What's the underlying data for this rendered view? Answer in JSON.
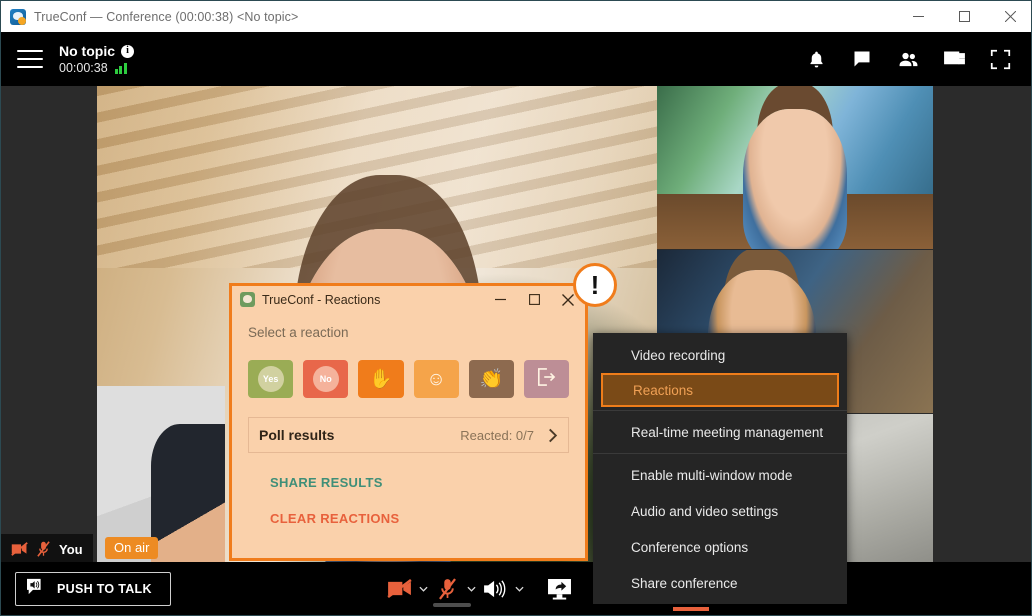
{
  "window": {
    "title": "TrueConf — Conference (00:00:38) <No topic>",
    "app_icon": "trueconf-icon",
    "controls": [
      {
        "name": "minimize-button",
        "glyph": "minimize-icon"
      },
      {
        "name": "maximize-button",
        "glyph": "maximize-icon"
      },
      {
        "name": "close-button",
        "glyph": "close-icon"
      }
    ]
  },
  "header": {
    "menu_icon": "hamburger-icon",
    "topic": "No topic",
    "info_glyph": "i",
    "elapsed": "00:00:38",
    "signal_icon": "signal-bars-icon",
    "actions": [
      {
        "name": "notifications-button",
        "icon": "bell-icon"
      },
      {
        "name": "chat-button",
        "icon": "chat-bubble-icon"
      },
      {
        "name": "participants-button",
        "icon": "people-icon"
      },
      {
        "name": "layout-button",
        "icon": "video-layout-icon"
      },
      {
        "name": "fullscreen-button",
        "icon": "fullscreen-icon"
      }
    ]
  },
  "stage": {
    "self_tile": {
      "name_label": "You",
      "status_badge": "On air",
      "camera_icon": "camera-off-icon",
      "mic_icon": "mic-off-icon"
    },
    "tiles": [
      {
        "name": "video-tile-speaker"
      },
      {
        "name": "video-tile-participant-1"
      },
      {
        "name": "video-tile-participant-2"
      },
      {
        "name": "video-tile-participant-3"
      }
    ]
  },
  "bottombar": {
    "push_to_talk": {
      "label": "PUSH TO TALK",
      "icon": "speaker-bubble-icon"
    },
    "controls": [
      {
        "name": "camera-toggle",
        "icon": "camera-off-icon",
        "state": "off",
        "has_caret": true
      },
      {
        "name": "microphone-toggle",
        "icon": "mic-off-icon",
        "state": "off",
        "has_caret": true
      },
      {
        "name": "speaker-volume",
        "icon": "speaker-icon",
        "state": "on",
        "has_caret": true
      },
      {
        "name": "share-screen-button",
        "icon": "screen-share-icon",
        "state": "on",
        "has_caret": false
      }
    ],
    "more_icon": "more-dots-icon"
  },
  "context_menu": {
    "items": [
      {
        "label": "Video recording",
        "highlighted": false,
        "separator_after": false
      },
      {
        "label": "Reactions",
        "highlighted": true,
        "separator_after": true
      },
      {
        "label": "Real-time meeting management",
        "highlighted": false,
        "separator_after": true
      },
      {
        "label": "Enable multi-window mode",
        "highlighted": false,
        "separator_after": false
      },
      {
        "label": "Audio and video settings",
        "highlighted": false,
        "separator_after": false
      },
      {
        "label": "Conference options",
        "highlighted": false,
        "separator_after": false
      },
      {
        "label": "Share conference",
        "highlighted": false,
        "separator_after": false
      }
    ],
    "highlight_border_color": "#ef7d1a",
    "highlight_fill_color": "#7a4a17"
  },
  "dialog": {
    "icon": "trueconf-icon",
    "title": "TrueConf - Reactions",
    "controls": [
      {
        "name": "dialog-minimize-button",
        "glyph": "minimize-icon"
      },
      {
        "name": "dialog-maximize-button",
        "glyph": "maximize-icon"
      },
      {
        "name": "dialog-close-button",
        "glyph": "close-icon"
      }
    ],
    "prompt": "Select a reaction",
    "reactions": [
      {
        "name": "reaction-yes",
        "label": "Yes",
        "kind": "pill",
        "color": "#9aac55"
      },
      {
        "name": "reaction-no",
        "label": "No",
        "kind": "pill",
        "color": "#e8674a"
      },
      {
        "name": "reaction-raise-hand",
        "label": "✋",
        "kind": "glyph",
        "color": "#f07c1b"
      },
      {
        "name": "reaction-smile",
        "label": "☺",
        "kind": "glyph",
        "color": "#f5a44a"
      },
      {
        "name": "reaction-applause",
        "label": "👏",
        "kind": "glyph",
        "color": "#8d6a4f"
      },
      {
        "name": "reaction-leave",
        "label": "⇥",
        "kind": "glyph",
        "color": "#bd8e96"
      }
    ],
    "poll": {
      "title": "Poll results",
      "count_label": "Reacted: 0/7",
      "chevron": "chevron-right-icon"
    },
    "share_results_label": "SHARE RESULTS",
    "clear_reactions_label": "CLEAR REACTIONS",
    "accent_color": "#f07c1b",
    "background_color": "#fad1ab"
  },
  "alert_badge": {
    "glyph": "!",
    "name": "alert-exclamation-badge"
  }
}
